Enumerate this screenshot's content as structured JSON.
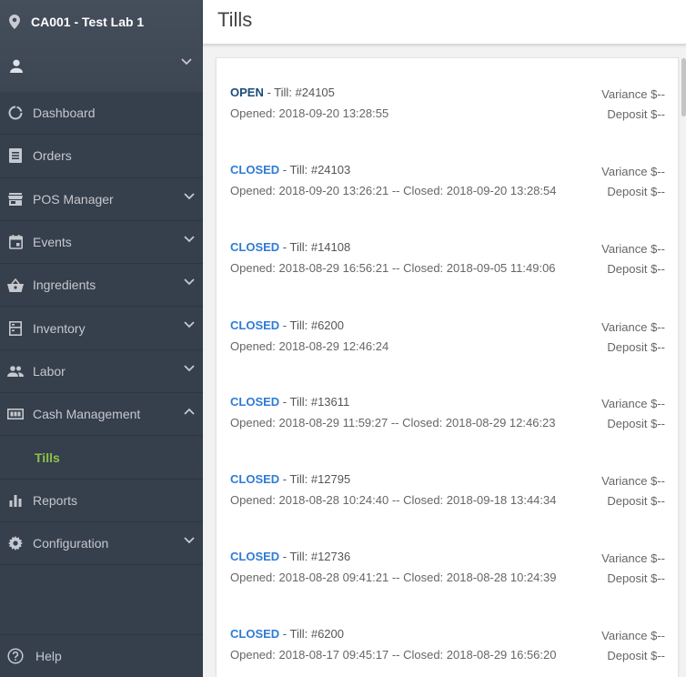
{
  "sidebar": {
    "location": "CA001 - Test Lab 1",
    "items": [
      {
        "label": "Dashboard"
      },
      {
        "label": "Orders"
      },
      {
        "label": "POS Manager"
      },
      {
        "label": "Events"
      },
      {
        "label": "Ingredients"
      },
      {
        "label": "Inventory"
      },
      {
        "label": "Labor"
      },
      {
        "label": "Cash Management"
      },
      {
        "label": "Reports"
      },
      {
        "label": "Configuration"
      }
    ],
    "sub_item": "Tills",
    "help": "Help"
  },
  "header": {
    "title": "Tills"
  },
  "colors": {
    "sidebar_bg": "#363f4c",
    "active_sub": "#8bc34a",
    "open_status": "#1a4d7a",
    "closed_status": "#2f7bd6"
  },
  "tills": [
    {
      "status": "OPEN",
      "till": " - Till: #24105",
      "opened": "Opened: 2018-09-20 13:28:55",
      "closed": "",
      "variance": "Variance $--",
      "deposit": "Deposit $--"
    },
    {
      "status": "CLOSED",
      "till": " - Till: #24103",
      "opened": "Opened: 2018-09-20 13:26:21",
      "closed": " -- Closed: 2018-09-20 13:28:54",
      "variance": "Variance $--",
      "deposit": "Deposit $--"
    },
    {
      "status": "CLOSED",
      "till": " - Till: #14108",
      "opened": "Opened: 2018-08-29 16:56:21",
      "closed": " -- Closed: 2018-09-05 11:49:06",
      "variance": "Variance $--",
      "deposit": "Deposit $--"
    },
    {
      "status": "CLOSED",
      "till": " - Till: #6200",
      "opened": "Opened: 2018-08-29 12:46:24",
      "closed": "",
      "variance": "Variance $--",
      "deposit": "Deposit $--"
    },
    {
      "status": "CLOSED",
      "till": " - Till: #13611",
      "opened": "Opened: 2018-08-29 11:59:27",
      "closed": " -- Closed: 2018-08-29 12:46:23",
      "variance": "Variance $--",
      "deposit": "Deposit $--"
    },
    {
      "status": "CLOSED",
      "till": " - Till: #12795",
      "opened": "Opened: 2018-08-28 10:24:40",
      "closed": " -- Closed: 2018-09-18 13:44:34",
      "variance": "Variance $--",
      "deposit": "Deposit $--"
    },
    {
      "status": "CLOSED",
      "till": " - Till: #12736",
      "opened": "Opened: 2018-08-28 09:41:21",
      "closed": " -- Closed: 2018-08-28 10:24:39",
      "variance": "Variance $--",
      "deposit": "Deposit $--"
    },
    {
      "status": "CLOSED",
      "till": " - Till: #6200",
      "opened": "Opened: 2018-08-17 09:45:17",
      "closed": " -- Closed: 2018-08-29 16:56:20",
      "variance": "Variance $--",
      "deposit": "Deposit $--"
    }
  ]
}
